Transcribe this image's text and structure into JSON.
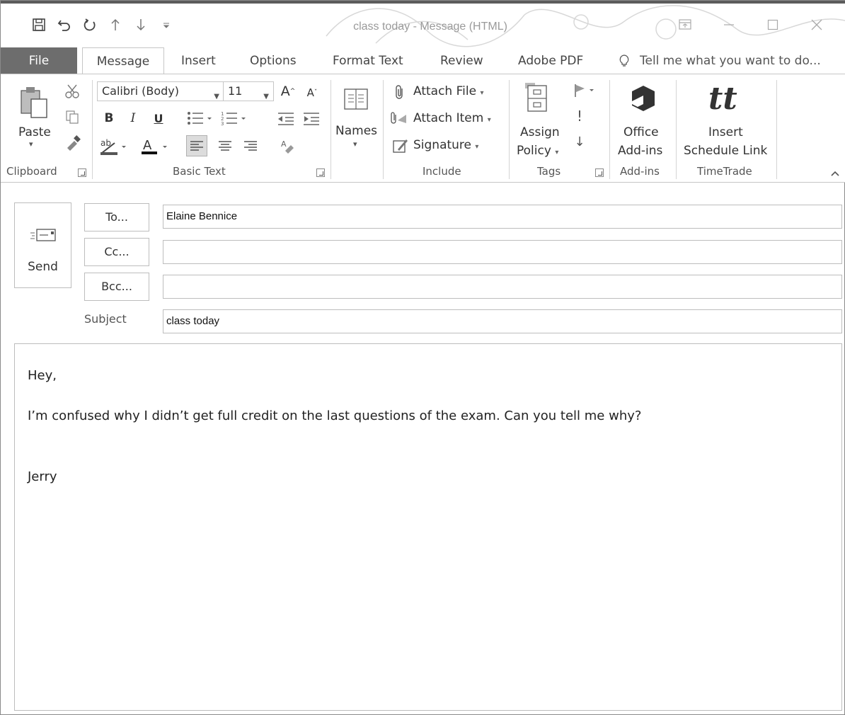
{
  "window": {
    "title": "class today - Message (HTML)"
  },
  "tabs": [
    "File",
    "Message",
    "Insert",
    "Options",
    "Format Text",
    "Review",
    "Adobe PDF"
  ],
  "tell_me": "Tell me what you want to do...",
  "ribbon": {
    "clipboard": {
      "paste": "Paste",
      "label": "Clipboard"
    },
    "basic_text": {
      "font": "Calibri (Body)",
      "size": "11",
      "label": "Basic Text"
    },
    "names": {
      "names": "Names"
    },
    "include": {
      "attach_file": "Attach File",
      "attach_item": "Attach Item",
      "signature": "Signature",
      "label": "Include"
    },
    "tags": {
      "assign": "Assign",
      "policy": "Policy",
      "label": "Tags"
    },
    "addins": {
      "office": "Office",
      "addins": "Add-ins",
      "label": "Add-ins"
    },
    "timetrade": {
      "insert": "Insert",
      "schedule": "Schedule Link",
      "label": "TimeTrade"
    }
  },
  "compose": {
    "send": "Send",
    "to_button": "To...",
    "cc_button": "Cc...",
    "bcc_button": "Bcc...",
    "to_value": "Elaine Bennice",
    "cc_value": "",
    "bcc_value": "",
    "subject_label": "Subject",
    "subject_value": "class today"
  },
  "body": {
    "greeting": "Hey,",
    "line1": "I’m confused why I didn’t get full credit on the last questions of the exam.  Can you tell me why?",
    "signoff": "Jerry"
  },
  "colors": {
    "file_tab": "#6d6d6d",
    "border": "#bdbdbd"
  }
}
